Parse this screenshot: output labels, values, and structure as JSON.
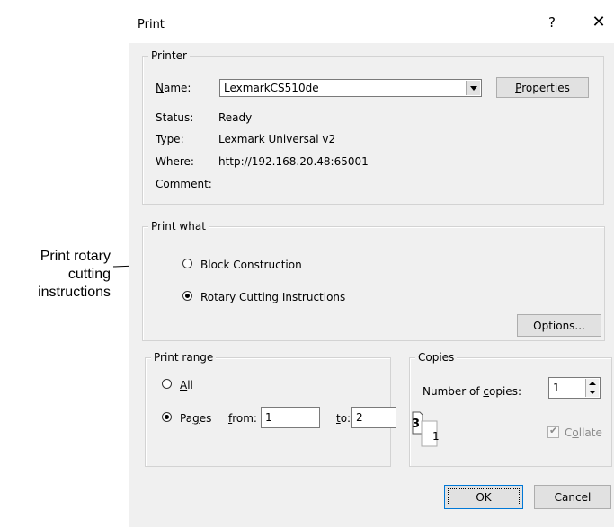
{
  "callout": {
    "lines": [
      "Print rotary",
      "cutting",
      "instructions"
    ]
  },
  "dialog": {
    "title": "Print",
    "help_glyph": "?",
    "close_glyph": "✕"
  },
  "printer": {
    "group_label": "Printer",
    "name_label_pre": "",
    "name_label_key": "N",
    "name_label_post": "ame:",
    "name_value": "LexmarkCS510de",
    "properties_key": "P",
    "properties_rest": "roperties",
    "status_label": "Status:",
    "status_value": "Ready",
    "type_label": "Type:",
    "type_value": "Lexmark Universal v2",
    "where_label": "Where:",
    "where_value": "http://192.168.20.48:65001",
    "comment_label": "Comment:"
  },
  "print_what": {
    "group_label": "Print what",
    "option_block": "Block Construction",
    "option_rotary": "Rotary Cutting Instructions",
    "options_button": "Options..."
  },
  "print_range": {
    "group_label": "Print range",
    "all_key": "A",
    "all_rest": "ll",
    "pages_pre": "Pa",
    "pages_key": "g",
    "pages_post": "es",
    "from_key": "f",
    "from_rest": "rom:",
    "from_value": "1",
    "to_key": "t",
    "to_rest": "o:",
    "to_value": "2"
  },
  "copies": {
    "group_label": "Copies",
    "number_pre": "Number of ",
    "number_key": "c",
    "number_post": "opies:",
    "number_value": "1",
    "icon_back": "3",
    "icon_front": "1",
    "collate_pre": "C",
    "collate_key": "o",
    "collate_post": "llate"
  },
  "buttons": {
    "ok": "OK",
    "cancel": "Cancel"
  }
}
